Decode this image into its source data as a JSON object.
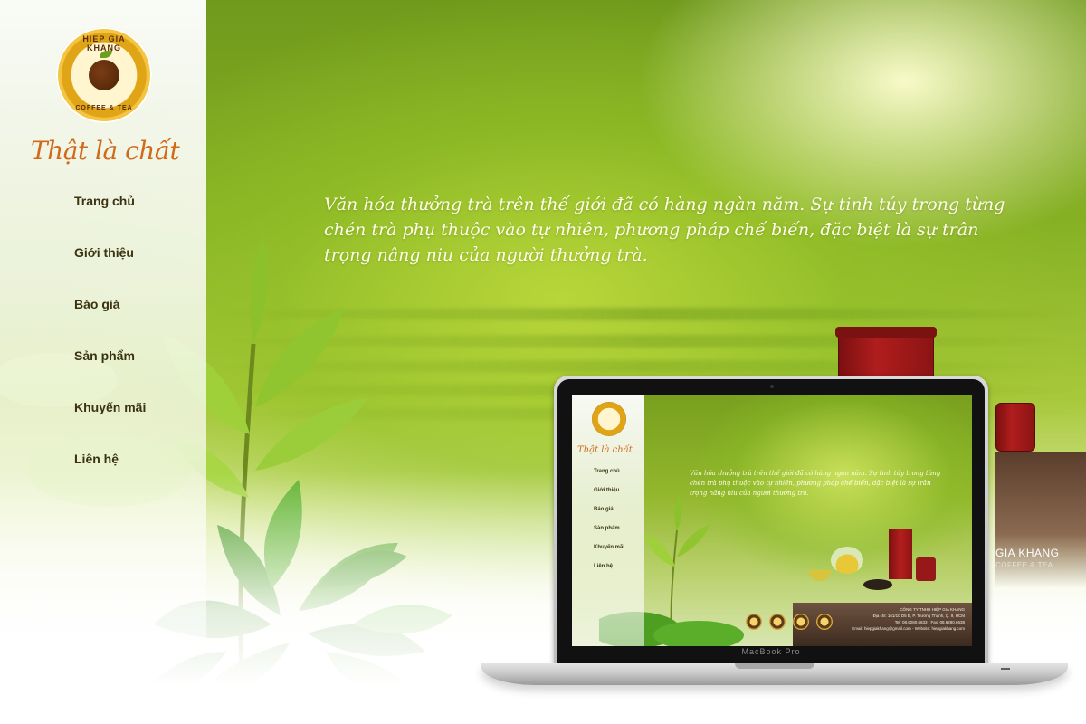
{
  "brand": {
    "logo_top": "HIEP GIA KHANG",
    "logo_bottom": "COFFEE & TEA",
    "tagline": "Thật là chất"
  },
  "menu": [
    "Trang chủ",
    "Giới thiệu",
    "Báo giá",
    "Sản phẩm",
    "Khuyến mãi",
    "Liên hệ"
  ],
  "intro": "Văn hóa thưởng trà  trên thế giới đã có hàng ngàn năm. Sự tinh túy trong từng chén trà phụ thuộc vào tự nhiên, phương pháp chế biến, đặc biệt là sự trân trọng nâng niu của người thưởng trà.",
  "laptop": {
    "brand": "MacBook Pro",
    "company_name": "CÔNG TY TNHH HIỆP GIA KHANG",
    "address": "Địa chỉ: 161/10 D5 B, P. Trường Thạnh, Q. 9, HCM",
    "phone": "Tel: 08.6280.6633 - Fax: 08.6280.6638",
    "contact": "Email: hiepgiakhang@gmail.com  -  Website: hiepgiakhang.com"
  },
  "side_text": {
    "line1": "GIA KHANG",
    "line2": "COFFEE & TEA"
  },
  "colors": {
    "accent": "#d06a1a",
    "menu_text": "#3b3310",
    "leaf_green": "#6aa01a",
    "box_red": "#b01d1d"
  }
}
